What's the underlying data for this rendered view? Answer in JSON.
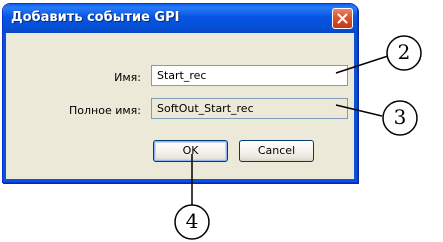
{
  "dialog": {
    "title": "Добавить событие GPI",
    "name_label": "Имя:",
    "name_value": "Start_rec",
    "full_name_label": "Полное имя:",
    "full_name_value": "SoftOut_Start_rec",
    "ok_label": "OK",
    "cancel_label": "Cancel",
    "close_icon": "close-icon"
  },
  "callouts": {
    "name_field": "2",
    "full_name_field": "3",
    "ok_button": "4"
  },
  "colors": {
    "titlebar": "#0655e3",
    "dialog_background": "#ece9d8",
    "close_button": "#d9532f",
    "field_border": "#7f9db9"
  }
}
